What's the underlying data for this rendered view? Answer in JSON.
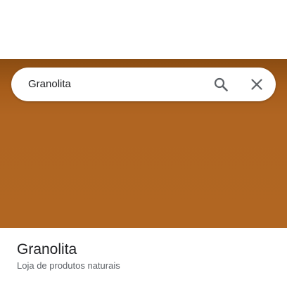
{
  "search": {
    "query": "Granolita",
    "search_icon": "search-icon",
    "close_icon": "close-icon"
  },
  "place": {
    "name": "Granolita",
    "category": "Loja de produtos naturais"
  },
  "colors": {
    "hero_top": "#8a4c12",
    "hero_main": "#b16622",
    "title_text": "#202124",
    "subtitle_text": "#5f6368",
    "icon": "#5f6368"
  }
}
